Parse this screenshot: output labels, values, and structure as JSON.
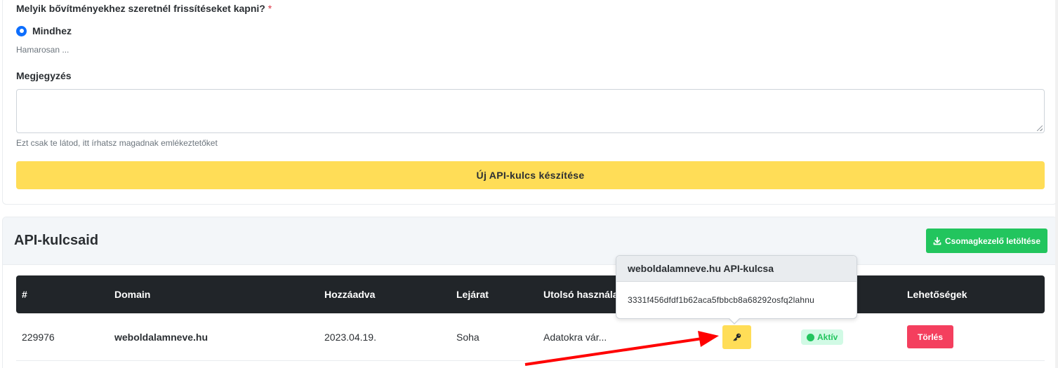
{
  "form": {
    "question": "Melyik bővítményekhez szeretnél frissítéseket kapni?",
    "required_mark": "*",
    "radio_option": "Mindhez",
    "hint_soon": "Hamarosan ...",
    "note_label": "Megjegyzés",
    "note_value": "",
    "note_hint": "Ezt csak te látod, itt írhatsz magadnak emlékeztetőket",
    "create_button": "Új API-kulcs készítése"
  },
  "keys": {
    "title": "API-kulcsaid",
    "download_button": "Csomagkezelő letöltése",
    "columns": [
      "#",
      "Domain",
      "Hozzáadva",
      "Lejárat",
      "Utolsó használat",
      "Lehetőségek"
    ],
    "rows": [
      {
        "id": "229976",
        "domain": "weboldalamneve.hu",
        "added": "2023.04.19.",
        "expiry": "Soha",
        "last_used": "Adatokra vár...",
        "status": "Aktív",
        "delete_button": "Törlés"
      }
    ]
  },
  "popover": {
    "title": "weboldalamneve.hu API-kulcsa",
    "key": "3331f456dfdf1b62aca5fbbcb8a68292osfq2lahnu"
  },
  "colors": {
    "accent_yellow": "#ffdd57",
    "success_green": "#22c55e",
    "danger_red": "#f43f5e",
    "annotation_arrow": "#ff0000"
  },
  "icons": {
    "key_button": "key-icon",
    "download": "download-icon",
    "status": "status-dot-icon"
  }
}
